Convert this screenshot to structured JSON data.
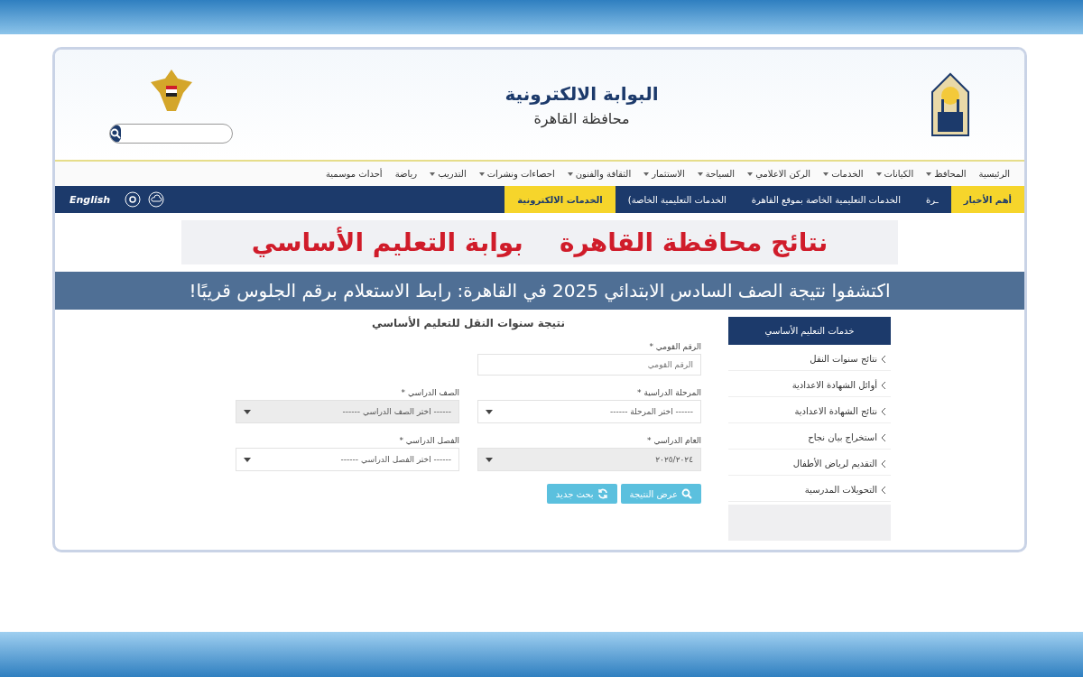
{
  "header": {
    "title": "البوابة الالكترونية",
    "subtitle": "محافظة القاهرة"
  },
  "nav": [
    {
      "label": "الرئيسية",
      "has_menu": false
    },
    {
      "label": "المحافظ",
      "has_menu": true
    },
    {
      "label": "الكيانات",
      "has_menu": true
    },
    {
      "label": "الخدمات",
      "has_menu": true
    },
    {
      "label": "الركن الاعلامي",
      "has_menu": true
    },
    {
      "label": "السياحة",
      "has_menu": true
    },
    {
      "label": "الاستثمار",
      "has_menu": true
    },
    {
      "label": "الثقافة والفنون",
      "has_menu": true
    },
    {
      "label": "احصاءات ونشرات",
      "has_menu": true
    },
    {
      "label": "التدريب",
      "has_menu": true
    },
    {
      "label": "رياضة",
      "has_menu": false
    },
    {
      "label": "أحداث موسمية",
      "has_menu": false
    }
  ],
  "news_bar": {
    "label": "أهم الأخبار",
    "items": [
      "ـرة",
      "الخدمات التعليمية الخاصة بموقع القاهرة",
      "الخدمات التعليمية الخاصة)"
    ],
    "services_tab": "الخدمات الالكترونية",
    "language": "English"
  },
  "banner": {
    "lines": [
      "نتائج محافظة القاهرة",
      "بوابة التعليم الأساسي"
    ]
  },
  "caption": "اكتشفوا نتيجة الصف السادس الابتدائي 2025 في القاهرة: رابط الاستعلام برقم الجلوس قريبًا!",
  "sidebar": {
    "title": "خدمات التعليم الأساسي",
    "items": [
      "نتائج سنوات النقل",
      "أوائل الشهادة الاعدادية",
      "نتائج الشهادة الاعدادية",
      "استخراج بيان نجاح",
      "التقديم لرياض الأطفال",
      "التحويلات المدرسية"
    ]
  },
  "form": {
    "title": "نتيجة سنوات النقل للتعليم الأساسي",
    "rows": [
      [
        {
          "label": "الرقم القومي *",
          "kind": "input",
          "placeholder": "الرقم القومي"
        }
      ],
      [
        {
          "label": "المرحلة الدراسية *",
          "kind": "select",
          "value": "------ اختر المرحلة ------",
          "disabled": false
        },
        {
          "label": "الصف الدراسي *",
          "kind": "select",
          "value": "------ اختر الصف الدراسي ------",
          "disabled": true
        }
      ],
      [
        {
          "label": "العام الدراسي *",
          "kind": "select",
          "value": "٢٠٢٥/٢٠٢٤",
          "disabled": true
        },
        {
          "label": "الفصل الدراسي *",
          "kind": "select",
          "value": "------ اختر الفصل الدراسي ------",
          "disabled": false
        }
      ]
    ],
    "buttons": [
      {
        "label": "عرض النتيجة"
      },
      {
        "label": "بحث جديد"
      }
    ]
  }
}
